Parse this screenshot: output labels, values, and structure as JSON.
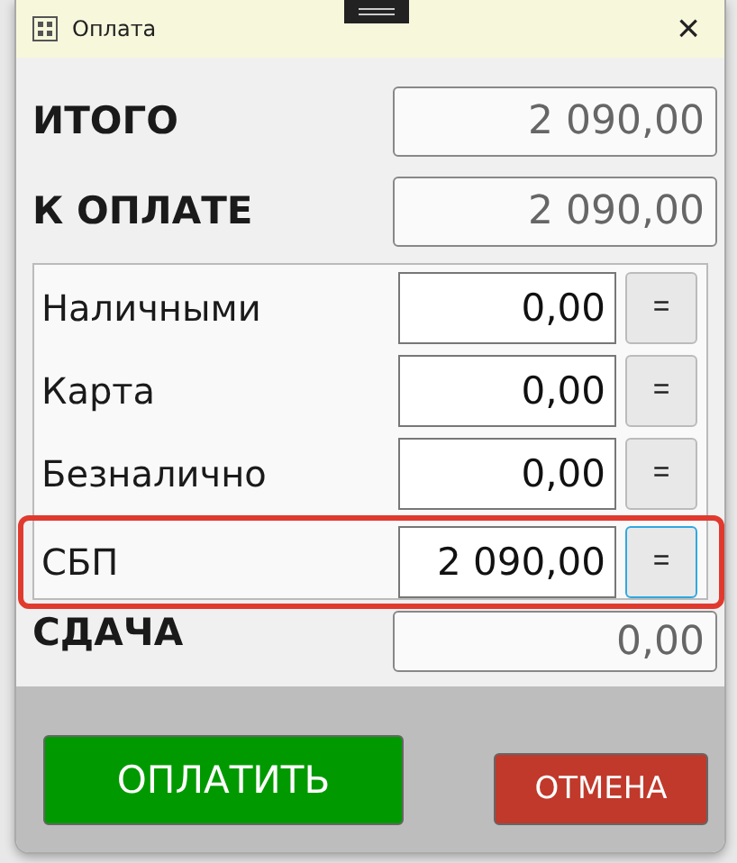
{
  "window": {
    "title": "Оплата",
    "close": "×"
  },
  "totals": [
    {
      "label": "ИТОГО",
      "value": "2 090,00"
    },
    {
      "label": "К ОПЛАТЕ",
      "value": "2 090,00"
    }
  ],
  "payments": [
    {
      "label": "Наличными",
      "value": "0,00",
      "button": "=",
      "selected": false
    },
    {
      "label": "Карта",
      "value": "0,00",
      "button": "=",
      "selected": false
    },
    {
      "label": "Безналично",
      "value": "0,00",
      "button": "=",
      "selected": false
    },
    {
      "label": "СБП",
      "value": "2 090,00",
      "button": "=",
      "selected": true
    }
  ],
  "change": {
    "label": "СДАЧА",
    "value": "0,00"
  },
  "buttons": [
    {
      "label": "ОПЛАТИТЬ",
      "kind": "confirm"
    },
    {
      "label": "ОТМЕНА",
      "kind": "cancel"
    }
  ]
}
